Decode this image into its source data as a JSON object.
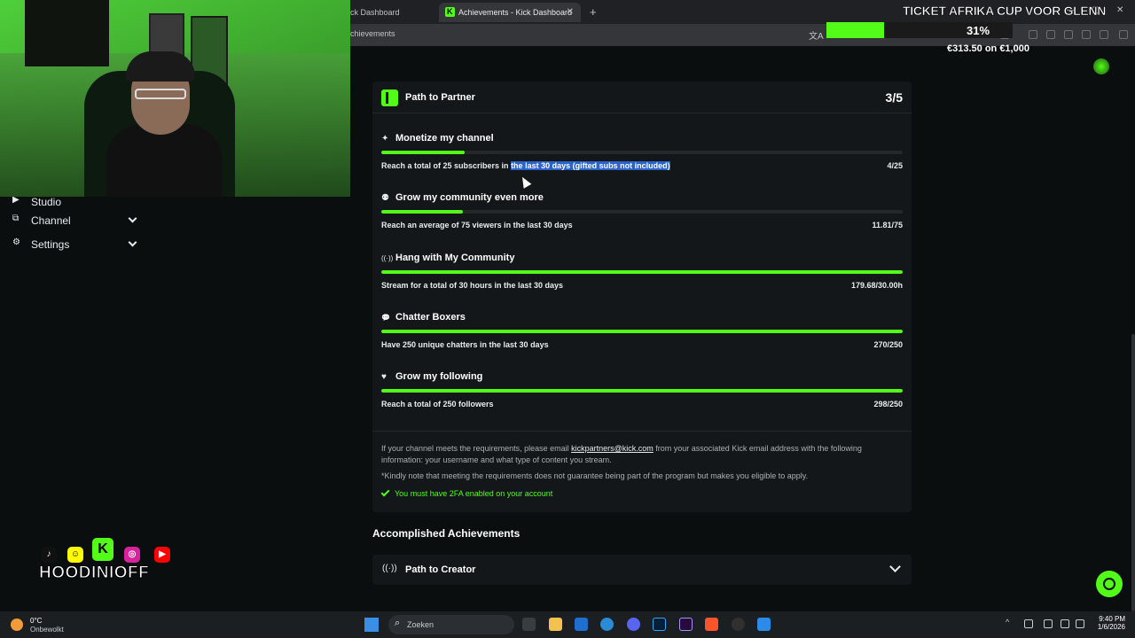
{
  "browser": {
    "tab_prev_label": "ck Dashboard",
    "tab_active_label": "Achievements - Kick Dashboard",
    "tab_close": "✕",
    "new_tab": "+",
    "url": "chievements"
  },
  "sidebar": {
    "items": [
      {
        "label": "Studio",
        "icon": "▶"
      },
      {
        "label": "Channel",
        "icon": "⧉"
      },
      {
        "label": "Settings",
        "icon": "⚙"
      }
    ]
  },
  "social": {
    "name": "HOODINIOFF"
  },
  "card": {
    "title": "Path to Partner",
    "progress": "3/5",
    "achievements": [
      {
        "title": "Monetize my channel",
        "icon": "✦",
        "desc_before": "Reach a total of 25 subscribers in ",
        "desc_highlight": "the last 30 days (gifted subs not included)",
        "value": "4/25",
        "progress": 0.16
      },
      {
        "title": "Grow my community even more",
        "icon": "⚉",
        "desc_before": "Reach an average of 75 viewers in the last 30 days",
        "desc_highlight": "",
        "value": "11.81/75",
        "progress": 0.157
      },
      {
        "title": "Hang with My Community",
        "icon": "((·))",
        "desc_before": "Stream for a total of 30 hours in the last 30 days",
        "desc_highlight": "",
        "value": "179.68/30.00h",
        "progress": 1.0
      },
      {
        "title": "Chatter Boxers",
        "icon": "💬",
        "desc_before": "Have 250 unique chatters in the last 30 days",
        "desc_highlight": "",
        "value": "270/250",
        "progress": 1.0
      },
      {
        "title": "Grow my following",
        "icon": "♥",
        "desc_before": "Reach a total of 250 followers",
        "desc_highlight": "",
        "value": "298/250",
        "progress": 1.0
      }
    ],
    "info_before": "If your channel meets the requirements, please email ",
    "info_email": "kickpartners@kick.com",
    "info_after": " from your associated Kick email address with the following information: your username and what type of content you stream.",
    "note": "*Kindly note that meeting the requirements does not guarantee being part of the program but makes you eligible to apply.",
    "requirement": "You must have 2FA enabled on your account"
  },
  "accomplished": {
    "heading": "Accomplished Achievements",
    "creator_label": "Path to Creator",
    "creator_icon": "((·))"
  },
  "overlay": {
    "goal_title": "TICKET AFRIKA CUP VOOR GLENN",
    "goal_percent": "31%",
    "goal_progress": 0.31,
    "goal_amount": "€313.50 on €1,000"
  },
  "taskbar": {
    "temp": "0°C",
    "weather": "Onbewolkt",
    "search_placeholder": "Zoeken",
    "time": "9:40 PM",
    "date": "1/6/2026"
  },
  "colors": {
    "accent": "#53fc18",
    "background": "#0b0e0f",
    "card": "#141719",
    "highlight": "#2a62c9"
  }
}
